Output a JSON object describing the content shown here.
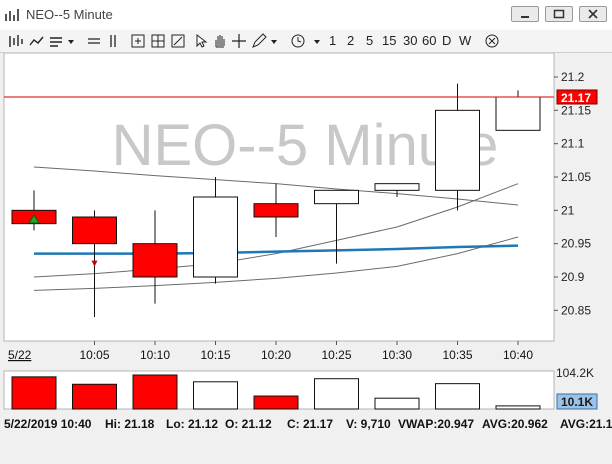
{
  "window": {
    "title": "NEO--5 Minute"
  },
  "toolbar": {
    "intervals": [
      "1",
      "2",
      "5",
      "15",
      "30",
      "60",
      "D",
      "W"
    ]
  },
  "chart_data": {
    "type": "candlestick",
    "title": "NEO--5 Minute",
    "date_label": "5/22",
    "x_labels": [
      "10:05",
      "10:10",
      "10:15",
      "10:20",
      "10:25",
      "10:30",
      "10:35",
      "10:40"
    ],
    "y_ticks": [
      "21.2",
      "21.15",
      "21.1",
      "21.05",
      "21",
      "20.95",
      "20.9",
      "20.85"
    ],
    "ylim": [
      20.81,
      21.23
    ],
    "current_price": "21.17",
    "price_line": 21.17,
    "candles": [
      {
        "o": 20.98,
        "h": 21.03,
        "l": 20.97,
        "c": 21.0,
        "up": false,
        "marker": "up"
      },
      {
        "o": 20.99,
        "h": 21.0,
        "l": 20.84,
        "c": 20.95,
        "up": false,
        "marker": "down"
      },
      {
        "o": 20.95,
        "h": 21.0,
        "l": 20.86,
        "c": 20.9,
        "up": false
      },
      {
        "o": 20.9,
        "h": 21.05,
        "l": 20.89,
        "c": 21.02,
        "up": true
      },
      {
        "o": 21.01,
        "h": 21.04,
        "l": 20.96,
        "c": 20.99,
        "up": false
      },
      {
        "o": 21.01,
        "h": 21.03,
        "l": 20.92,
        "c": 21.03,
        "up": true
      },
      {
        "o": 21.03,
        "h": 21.04,
        "l": 21.02,
        "c": 21.04,
        "up": true
      },
      {
        "o": 21.03,
        "h": 21.19,
        "l": 21.0,
        "c": 21.15,
        "up": true
      },
      {
        "o": 21.12,
        "h": 21.18,
        "l": 21.12,
        "c": 21.17,
        "up": true
      }
    ],
    "vwap": [
      20.935,
      20.935,
      20.935,
      20.936,
      20.938,
      20.94,
      20.942,
      20.945,
      20.947
    ],
    "upper_band": [
      21.065,
      21.059,
      21.052,
      21.046,
      21.04,
      21.032,
      21.025,
      21.017,
      21.008
    ],
    "mid_line": [
      20.9,
      20.905,
      20.912,
      20.92,
      20.935,
      20.955,
      20.975,
      21.005,
      21.04
    ],
    "lower_band": [
      20.88,
      20.883,
      20.887,
      20.892,
      20.898,
      20.906,
      20.916,
      20.935,
      20.96
    ],
    "volume": {
      "max_label": "104.2K",
      "current_label": "10.1K",
      "values": [
        104,
        80,
        110,
        88,
        42,
        98,
        35,
        82,
        10.1
      ],
      "up": [
        false,
        false,
        false,
        true,
        false,
        true,
        true,
        true,
        true
      ]
    }
  },
  "status": {
    "date": "5/22/2019 10:40",
    "hi": "Hi: 21.18",
    "lo": "Lo: 21.12",
    "o": "O: 21.12",
    "c": "C: 21.17",
    "v": "V: 9,710",
    "vwap": "VWAP:20.947",
    "avg": "AVG:20.962",
    "avg2": "AVG:21.1"
  },
  "colors": {
    "down_fill": "#ff0000",
    "up_fill": "#ffffff",
    "vwap": "#1f77b4",
    "price_line": "#d00000",
    "watermark": "#c8c8c8"
  }
}
